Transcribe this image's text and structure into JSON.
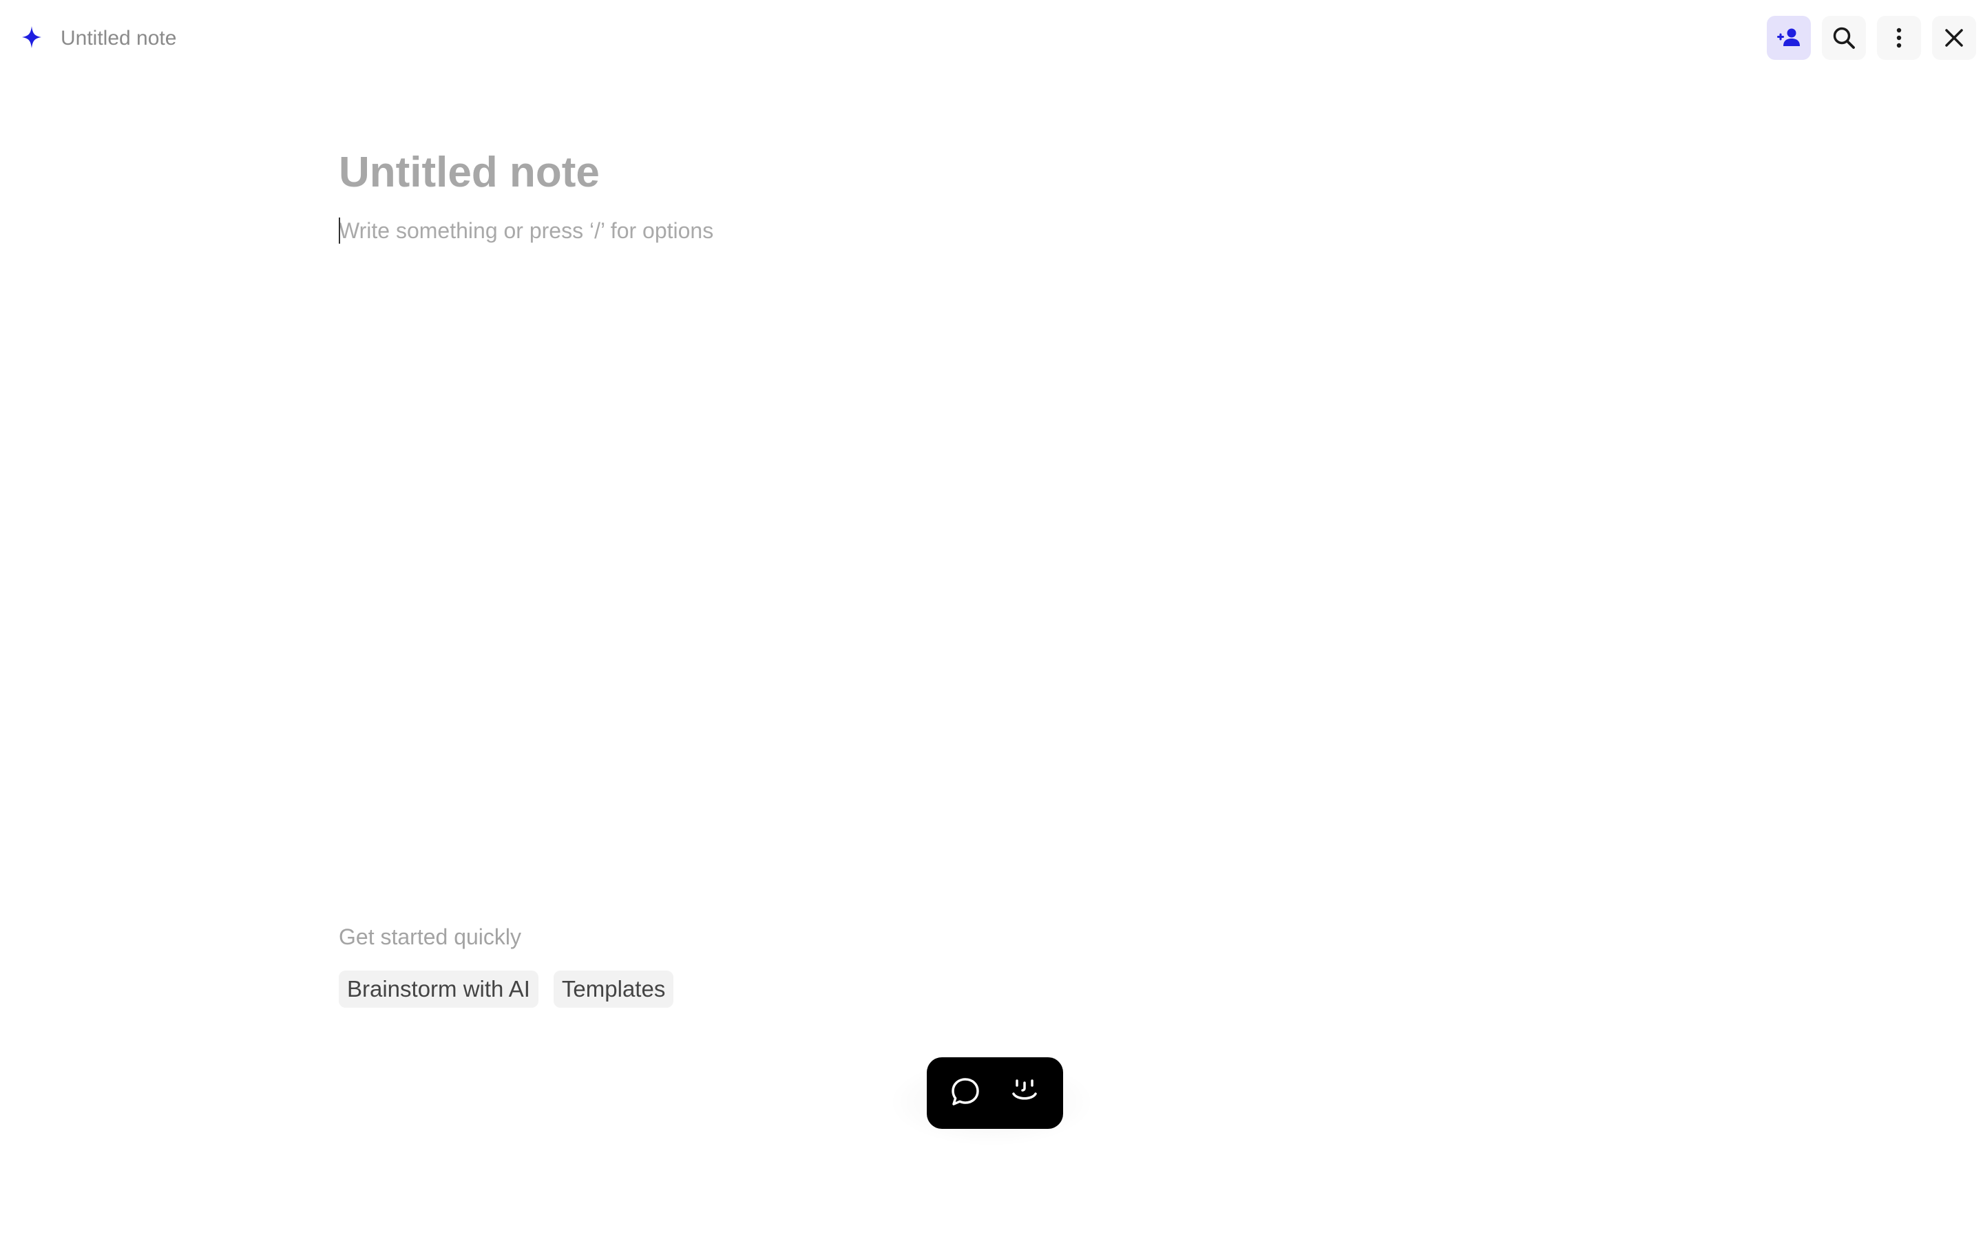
{
  "header": {
    "note_title": "Untitled note",
    "icons": [
      "sparkle-icon",
      "person-add-icon",
      "search-icon",
      "more-vertical-icon",
      "close-icon"
    ],
    "accent_color": "#1f1fe0",
    "share_button_bg": "#e5e2fb"
  },
  "editor": {
    "title_placeholder": "Untitled note",
    "body_placeholder": "Write something or press ‘/’ for options"
  },
  "quickstart": {
    "heading": "Get started quickly",
    "chips": [
      {
        "label": "Brainstorm with AI"
      },
      {
        "label": "Templates"
      }
    ]
  },
  "floating_toolbar": {
    "icons": [
      "chat-bubble-icon",
      "smiley-face-icon"
    ],
    "background": "#000000"
  }
}
